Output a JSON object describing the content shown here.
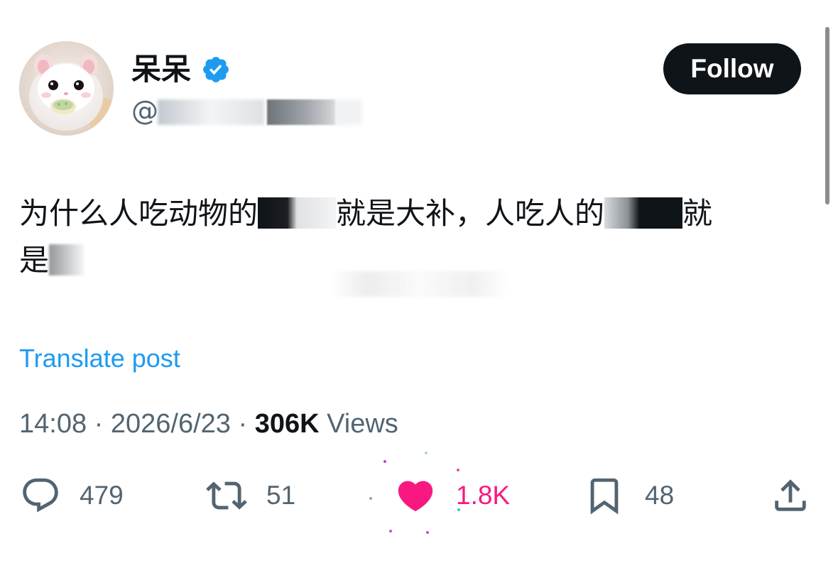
{
  "user": {
    "display_name": "呆呆",
    "handle": "@",
    "verified": true,
    "avatar": "white-hamster-photo"
  },
  "follow_button": {
    "label": "Follow"
  },
  "post": {
    "line1_a": "为什么人吃动物的",
    "line1_b": "就是大补，人吃人的",
    "line1_c": "就",
    "line2": "是",
    "translate_label": "Translate post"
  },
  "meta": {
    "time": "14:08",
    "sep1": " · ",
    "date": "2026/6/23",
    "sep2": " · ",
    "views_count": "306K",
    "views_label": " Views"
  },
  "actions": {
    "reply": {
      "icon": "reply-icon",
      "count": "479"
    },
    "repost": {
      "icon": "repost-icon",
      "count": "51"
    },
    "like": {
      "icon": "heart-icon",
      "count": "1.8K",
      "active": true
    },
    "bookmark": {
      "icon": "bookmark-icon",
      "count": "48"
    },
    "share": {
      "icon": "share-icon"
    }
  },
  "colors": {
    "text": "#0f1419",
    "muted": "#536471",
    "link": "#1d9bf0",
    "like": "#f91880",
    "verified": "#1d9bf0"
  }
}
